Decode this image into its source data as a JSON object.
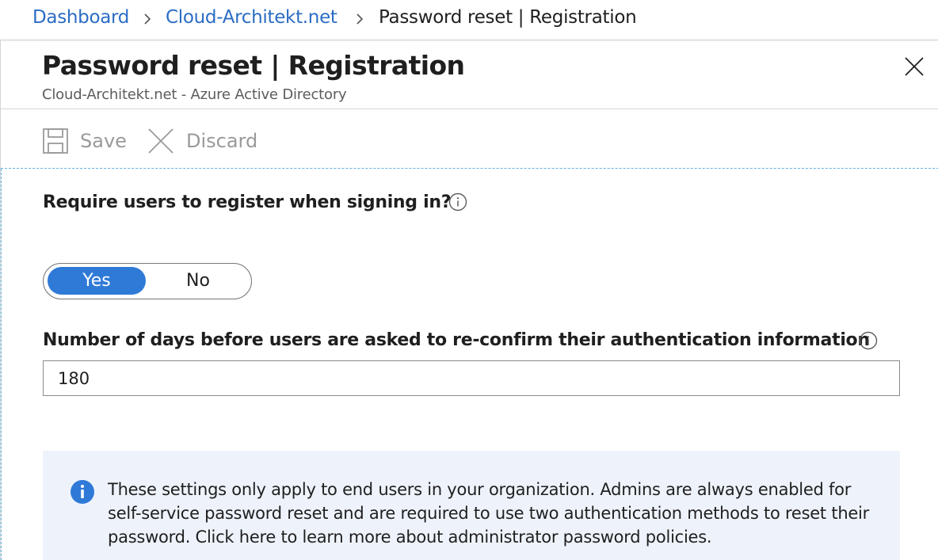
{
  "breadcrumb": {
    "items": [
      {
        "label": "Dashboard"
      },
      {
        "label": "Cloud-Architekt.net"
      },
      {
        "label": "Password reset | Registration"
      }
    ]
  },
  "blade": {
    "title": "Password reset | Registration",
    "subtitle": "Cloud-Architekt.net - Azure Active Directory"
  },
  "toolbar": {
    "save_label": "Save",
    "discard_label": "Discard"
  },
  "form": {
    "require_register": {
      "label": "Require users to register when signing in?",
      "options": [
        "Yes",
        "No"
      ],
      "selected": "Yes"
    },
    "reconfirm_days": {
      "label": "Number of days before users are asked to re-confirm their authentication information",
      "value": "180"
    }
  },
  "notice": {
    "text": "These settings only apply to end users in your organization. Admins are always enabled for self-service password reset and are required to use two authentication methods to reset their password. Click here to learn more about administrator password policies."
  },
  "colors": {
    "link": "#2b6cc4",
    "accent": "#2f7ad7",
    "notice_bg": "#eef3fb",
    "disabled": "#9a9a9a",
    "focus_dash": "#5eb6e4"
  },
  "icons": {
    "breadcrumb_separator": "chevron-right-icon",
    "close": "close-icon",
    "save": "save-icon",
    "discard": "discard-icon",
    "info": "info-icon",
    "notice": "info-filled-icon"
  }
}
